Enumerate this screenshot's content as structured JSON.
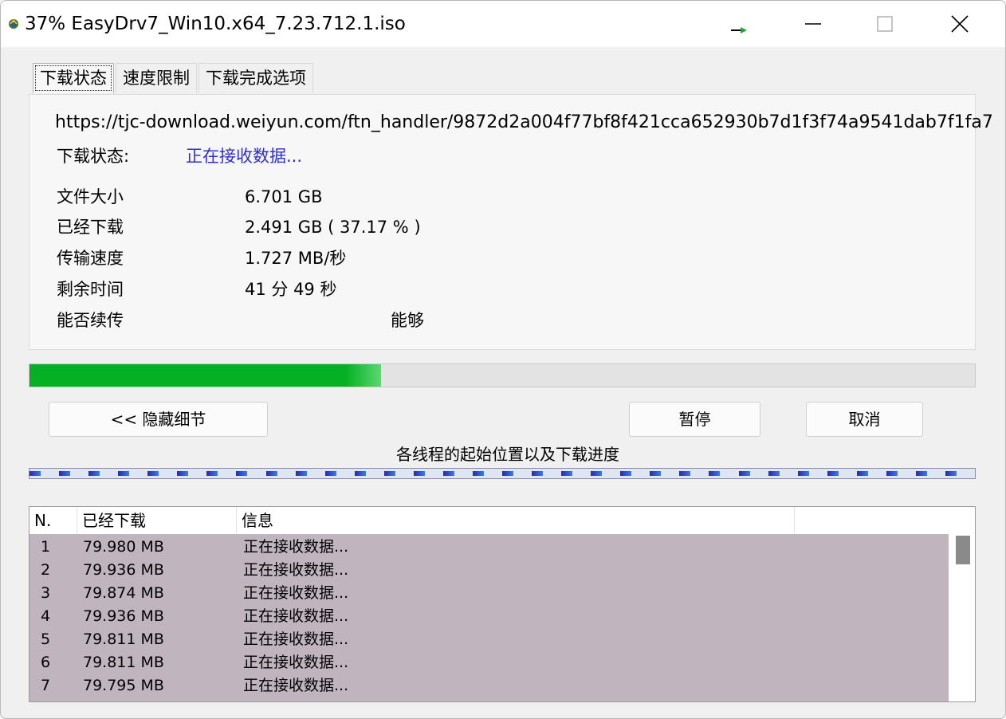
{
  "window": {
    "title": "37% EasyDrv7_Win10.x64_7.23.712.1.iso"
  },
  "tabs": [
    {
      "label": "下载状态",
      "active": true
    },
    {
      "label": "速度限制",
      "active": false
    },
    {
      "label": "下载完成选项",
      "active": false
    }
  ],
  "status": {
    "url": "https://tjc-download.weiyun.com/ftn_handler/9872d2a004f77bf8f421cca652930b7d1f3f74a9541dab7f1fa7",
    "state_label": "下载状态:",
    "state_value": "正在接收数据...",
    "file_size_label": "文件大小",
    "file_size_value": "6.701  GB",
    "downloaded_label": "已经下载",
    "downloaded_value": "2.491  GB ( 37.17 % )",
    "speed_label": "传输速度",
    "speed_value": "1.727  MB/秒",
    "remaining_label": "剩余时间",
    "remaining_value": "41 分 49 秒",
    "resume_label": "能否续传",
    "resume_value": "能够"
  },
  "progress": {
    "percent": 37.17,
    "color": "#06b025"
  },
  "buttons": {
    "hide_details": "<< 隐藏细节",
    "pause": "暂停",
    "cancel": "取消"
  },
  "threads": {
    "label": "各线程的起始位置以及下载进度",
    "segment_count": 32
  },
  "list": {
    "columns": [
      "N.",
      "已经下载",
      "信息",
      ""
    ],
    "rows": [
      {
        "n": "1",
        "downloaded": "79.980  MB",
        "info": "正在接收数据..."
      },
      {
        "n": "2",
        "downloaded": "79.936  MB",
        "info": "正在接收数据..."
      },
      {
        "n": "3",
        "downloaded": "79.874  MB",
        "info": "正在接收数据..."
      },
      {
        "n": "4",
        "downloaded": "79.936  MB",
        "info": "正在接收数据..."
      },
      {
        "n": "5",
        "downloaded": "79.811  MB",
        "info": "正在接收数据..."
      },
      {
        "n": "6",
        "downloaded": "79.811  MB",
        "info": "正在接收数据..."
      },
      {
        "n": "7",
        "downloaded": "79.795  MB",
        "info": "正在接收数据..."
      }
    ],
    "row_bg": "#c0b5bf"
  }
}
